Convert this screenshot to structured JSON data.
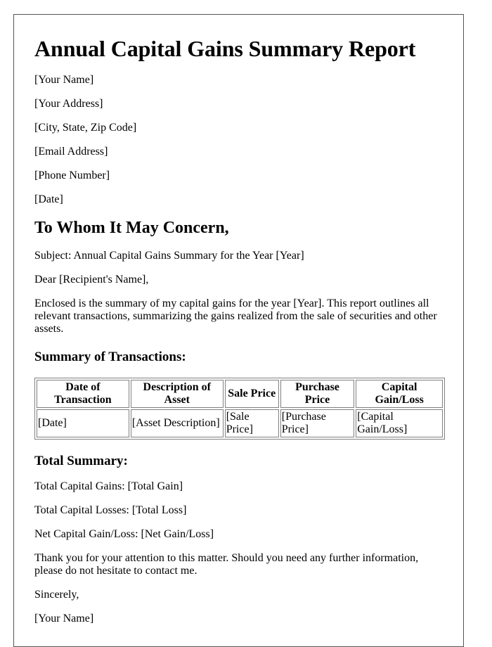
{
  "title": "Annual Capital Gains Summary Report",
  "sender": {
    "name": "[Your Name]",
    "address": "[Your Address]",
    "city_state_zip": "[City, State, Zip Code]",
    "email": "[Email Address]",
    "phone": "[Phone Number]",
    "date": "[Date]"
  },
  "salutation_heading": "To Whom It May Concern,",
  "subject": "Subject: Annual Capital Gains Summary for the Year [Year]",
  "greeting": "Dear [Recipient's Name],",
  "intro": "Enclosed is the summary of my capital gains for the year [Year]. This report outlines all relevant transactions, summarizing the gains realized from the sale of securities and other assets.",
  "transactions": {
    "heading": "Summary of Transactions:",
    "columns": [
      "Date of Transaction",
      "Description of Asset",
      "Sale Price",
      "Purchase Price",
      "Capital Gain/Loss"
    ],
    "rows": [
      [
        "[Date]",
        "[Asset Description]",
        "[Sale Price]",
        "[Purchase Price]",
        "[Capital Gain/Loss]"
      ]
    ]
  },
  "total_summary": {
    "heading": "Total Summary:",
    "gains": "Total Capital Gains: [Total Gain]",
    "losses": "Total Capital Losses: [Total Loss]",
    "net": "Net Capital Gain/Loss: [Net Gain/Loss]"
  },
  "closing_text": "Thank you for your attention to this matter. Should you need any further information, please do not hesitate to contact me.",
  "sign_off": "Sincerely,",
  "signature": "[Your Name]"
}
